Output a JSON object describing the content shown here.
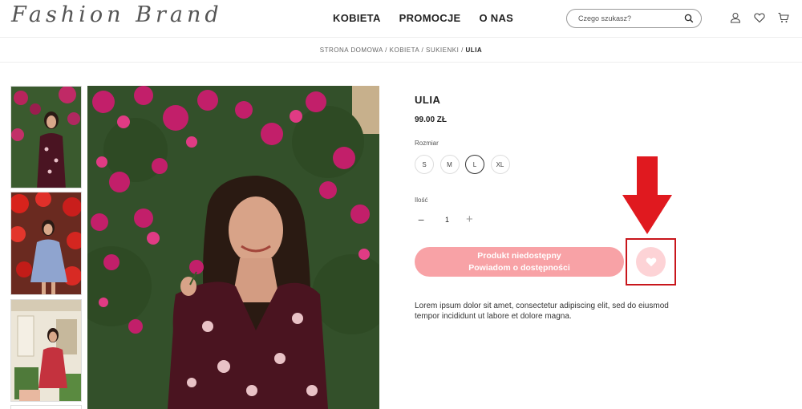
{
  "header": {
    "logo": "Fashion Brand",
    "nav": [
      "KOBIETA",
      "PROMOCJE",
      "O NAS"
    ],
    "search_placeholder": "Czego szukasz?",
    "icons": [
      "search-icon",
      "user-icon",
      "heart-icon",
      "cart-icon"
    ]
  },
  "breadcrumb": {
    "items": [
      "STRONA DOMOWA",
      "KOBIETA",
      "SUKIENKI"
    ],
    "current": "ULIA",
    "separator": "/"
  },
  "product": {
    "name": "ULIA",
    "price": "99.00 ZŁ",
    "size_label": "Rozmiar",
    "sizes": [
      "S",
      "M",
      "L",
      "XL"
    ],
    "selected_size": "L",
    "quantity_label": "Ilość",
    "quantity": "1",
    "quantity_minus": "−",
    "quantity_plus": "+",
    "cta_line1": "Produkt niedostępny",
    "cta_line2": "Powiadom o dostępności",
    "description": "Lorem ipsum dolor sit amet, consectetur adipiscing elit, sed do eiusmod tempor incididunt ut labore et dolore magna."
  },
  "colors": {
    "accent": "#f8a2a6",
    "wishlist_bg": "#fdd3d6",
    "highlight_red": "#e0191f"
  }
}
